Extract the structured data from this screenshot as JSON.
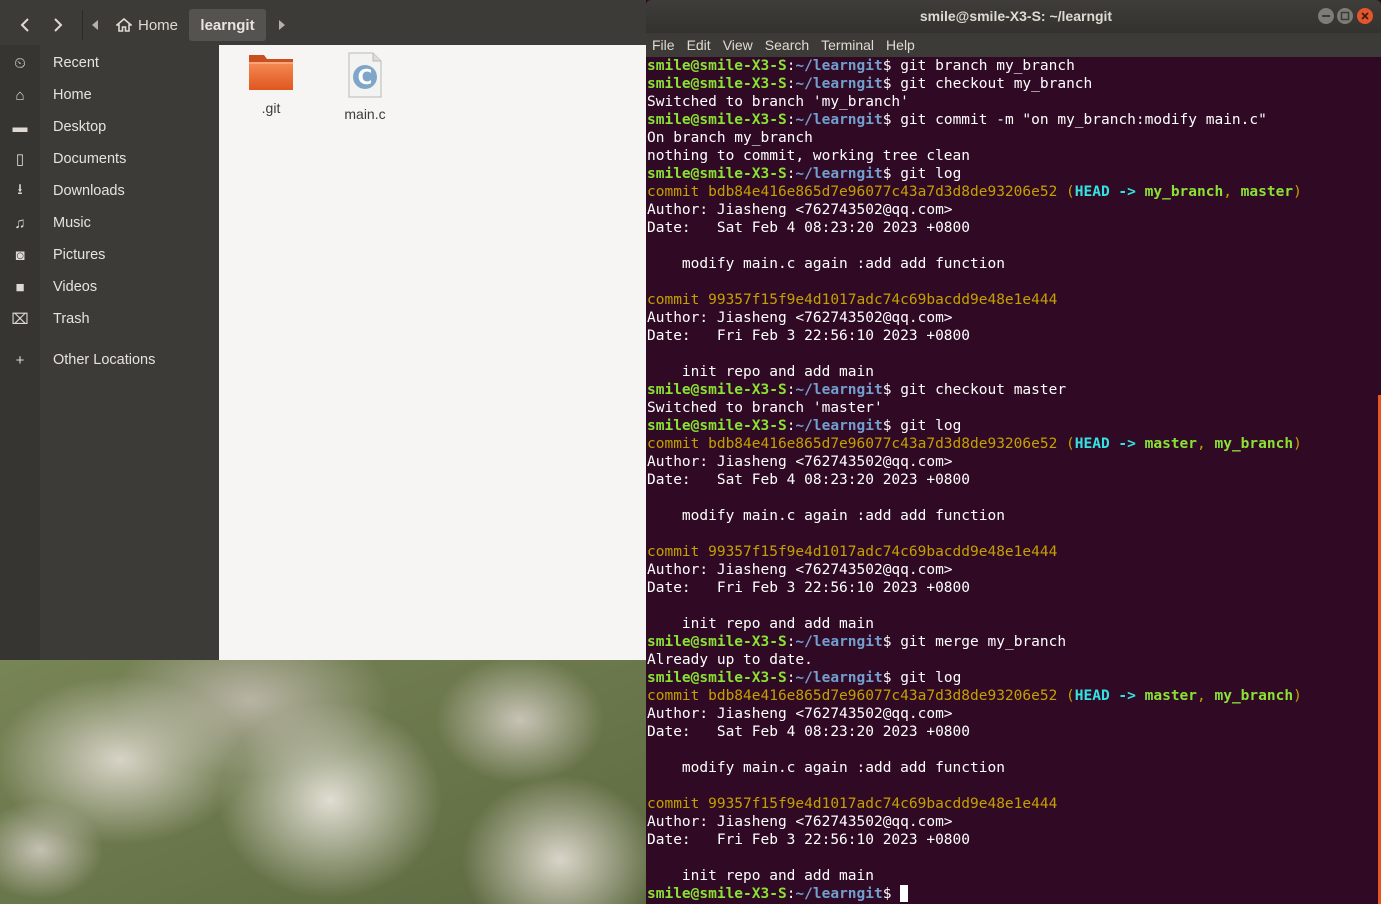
{
  "file_manager": {
    "path": {
      "home_label": "Home",
      "current_label": "learngit"
    },
    "sidebar": [
      {
        "icon": "clock-icon",
        "glyph": "⏲",
        "label": "Recent"
      },
      {
        "icon": "home-icon",
        "glyph": "⌂",
        "label": "Home"
      },
      {
        "icon": "folder-icon",
        "glyph": "▬",
        "label": "Desktop"
      },
      {
        "icon": "document-icon",
        "glyph": "▯",
        "label": "Documents"
      },
      {
        "icon": "download-icon",
        "glyph": "⭳",
        "label": "Downloads"
      },
      {
        "icon": "music-icon",
        "glyph": "♫",
        "label": "Music"
      },
      {
        "icon": "camera-icon",
        "glyph": "◙",
        "label": "Pictures"
      },
      {
        "icon": "video-icon",
        "glyph": "■",
        "label": "Videos"
      },
      {
        "icon": "trash-icon",
        "glyph": "⌧",
        "label": "Trash"
      },
      {
        "icon": "plus-icon",
        "glyph": "+",
        "label": "Other Locations"
      }
    ],
    "files": [
      {
        "name": ".git",
        "icon": "folder-icon"
      },
      {
        "name": "main.c",
        "icon": "c-source-file-icon"
      }
    ]
  },
  "terminal": {
    "title": "smile@smile-X3-S: ~/learngit",
    "menu": [
      "File",
      "Edit",
      "View",
      "Search",
      "Terminal",
      "Help"
    ],
    "prompt_user": "smile@smile-X3-S",
    "prompt_path": "~/learngit",
    "lines": [
      {
        "kind": "cmd",
        "text": "git branch my_branch"
      },
      {
        "kind": "cmd",
        "text": "git checkout my_branch"
      },
      {
        "kind": "out",
        "text": "Switched to branch 'my_branch'"
      },
      {
        "kind": "cmd",
        "text": "git commit -m \"on my_branch:modify main.c\""
      },
      {
        "kind": "out",
        "text": "On branch my_branch"
      },
      {
        "kind": "out",
        "text": "nothing to commit, working tree clean"
      },
      {
        "kind": "cmd",
        "text": "git log"
      },
      {
        "kind": "commit",
        "hash": "commit bdb84e416e865d7e96077c43a7d3d8de93206e52",
        "head": "HEAD",
        "arrow": "->",
        "refs": [
          "my_branch",
          "master"
        ]
      },
      {
        "kind": "out",
        "text": "Author: Jiasheng <762743502@qq.com>"
      },
      {
        "kind": "out",
        "text": "Date:   Sat Feb 4 08:23:20 2023 +0800"
      },
      {
        "kind": "out",
        "text": ""
      },
      {
        "kind": "out",
        "text": "    modify main.c again :add add function"
      },
      {
        "kind": "out",
        "text": ""
      },
      {
        "kind": "commit",
        "hash": "commit 99357f15f9e4d1017adc74c69bacdd9e48e1e444"
      },
      {
        "kind": "out",
        "text": "Author: Jiasheng <762743502@qq.com>"
      },
      {
        "kind": "out",
        "text": "Date:   Fri Feb 3 22:56:10 2023 +0800"
      },
      {
        "kind": "out",
        "text": ""
      },
      {
        "kind": "out",
        "text": "    init repo and add main"
      },
      {
        "kind": "cmd",
        "text": "git checkout master"
      },
      {
        "kind": "out",
        "text": "Switched to branch 'master'"
      },
      {
        "kind": "cmd",
        "text": "git log"
      },
      {
        "kind": "commit",
        "hash": "commit bdb84e416e865d7e96077c43a7d3d8de93206e52",
        "head": "HEAD",
        "arrow": "->",
        "refs": [
          "master",
          "my_branch"
        ]
      },
      {
        "kind": "out",
        "text": "Author: Jiasheng <762743502@qq.com>"
      },
      {
        "kind": "out",
        "text": "Date:   Sat Feb 4 08:23:20 2023 +0800"
      },
      {
        "kind": "out",
        "text": ""
      },
      {
        "kind": "out",
        "text": "    modify main.c again :add add function"
      },
      {
        "kind": "out",
        "text": ""
      },
      {
        "kind": "commit",
        "hash": "commit 99357f15f9e4d1017adc74c69bacdd9e48e1e444"
      },
      {
        "kind": "out",
        "text": "Author: Jiasheng <762743502@qq.com>"
      },
      {
        "kind": "out",
        "text": "Date:   Fri Feb 3 22:56:10 2023 +0800"
      },
      {
        "kind": "out",
        "text": ""
      },
      {
        "kind": "out",
        "text": "    init repo and add main"
      },
      {
        "kind": "cmd",
        "text": "git merge my_branch"
      },
      {
        "kind": "out",
        "text": "Already up to date."
      },
      {
        "kind": "cmd",
        "text": "git log"
      },
      {
        "kind": "commit",
        "hash": "commit bdb84e416e865d7e96077c43a7d3d8de93206e52",
        "head": "HEAD",
        "arrow": "->",
        "refs": [
          "master",
          "my_branch"
        ]
      },
      {
        "kind": "out",
        "text": "Author: Jiasheng <762743502@qq.com>"
      },
      {
        "kind": "out",
        "text": "Date:   Sat Feb 4 08:23:20 2023 +0800"
      },
      {
        "kind": "out",
        "text": ""
      },
      {
        "kind": "out",
        "text": "    modify main.c again :add add function"
      },
      {
        "kind": "out",
        "text": ""
      },
      {
        "kind": "commit",
        "hash": "commit 99357f15f9e4d1017adc74c69bacdd9e48e1e444"
      },
      {
        "kind": "out",
        "text": "Author: Jiasheng <762743502@qq.com>"
      },
      {
        "kind": "out",
        "text": "Date:   Fri Feb 3 22:56:10 2023 +0800"
      },
      {
        "kind": "out",
        "text": ""
      },
      {
        "kind": "out",
        "text": "    init repo and add main"
      },
      {
        "kind": "prompt",
        "text": ""
      }
    ]
  },
  "colors": {
    "terminal_bg": "#300a24",
    "prompt_user": "#8ae234",
    "prompt_path": "#729fcf",
    "commit_hash": "#c4a000",
    "head_ref": "#34e2e2",
    "branch_ref": "#8ae234",
    "sidebar_bg": "#3c3b37",
    "folder_orange": "#e95420"
  }
}
